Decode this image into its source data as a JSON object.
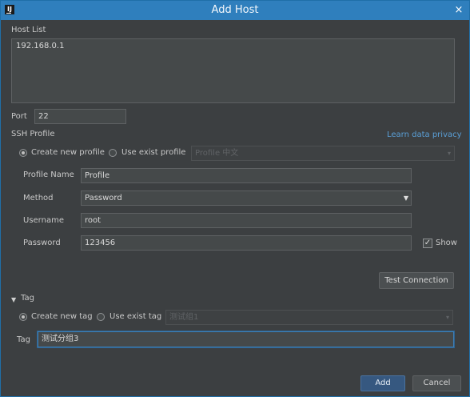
{
  "window": {
    "title": "Add Host",
    "app_icon_text": "IJ",
    "close_glyph": "×"
  },
  "host_list": {
    "label": "Host List",
    "value": "192.168.0.1"
  },
  "port": {
    "label": "Port",
    "value": "22"
  },
  "ssh_profile": {
    "label": "SSH Profile",
    "privacy_link": "Learn data privacy",
    "create_new_label": "Create new profile",
    "use_exist_label": "Use exist profile",
    "exist_profile_placeholder": "Profile 中文",
    "selected_mode": "create_new"
  },
  "profile_form": {
    "profile_name_label": "Profile Name",
    "profile_name_value": "Profile",
    "method_label": "Method",
    "method_value": "Password",
    "username_label": "Username",
    "username_value": "root",
    "password_label": "Password",
    "password_value": "123456",
    "show_label": "Show",
    "show_checked": true
  },
  "actions": {
    "test_connection": "Test Connection",
    "add": "Add",
    "cancel": "Cancel"
  },
  "tag": {
    "section_label": "Tag",
    "create_new_label": "Create new tag",
    "use_exist_label": "Use exist tag",
    "exist_tag_placeholder": "测试组1",
    "field_label": "Tag",
    "field_value": "测试分组3",
    "selected_mode": "create_new"
  },
  "colors": {
    "titlebar": "#2f7fbd",
    "background": "#3c3f41",
    "link": "#5a9fd6",
    "primary_button": "#365880"
  },
  "icons": {
    "collapse": "triangle-down-icon",
    "dropdown": "chevron-down-icon",
    "check": "check-icon"
  }
}
